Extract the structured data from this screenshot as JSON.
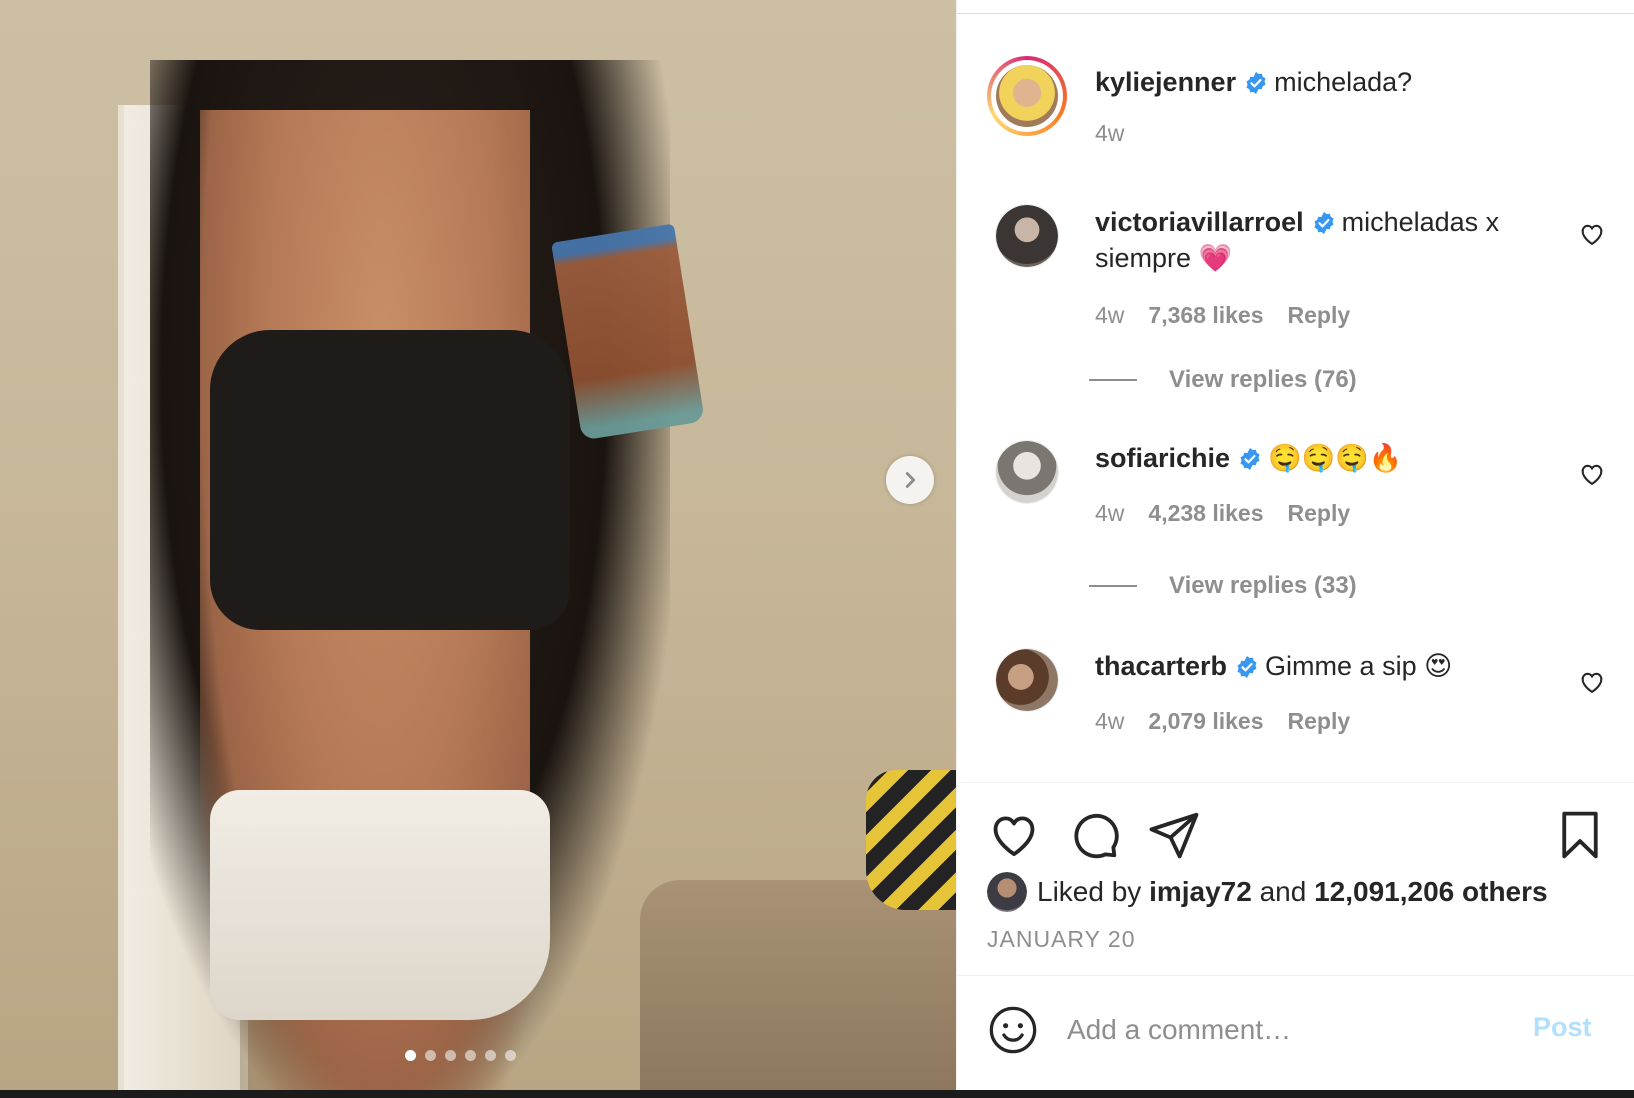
{
  "post": {
    "author": "kyliejenner",
    "caption": "michelada?",
    "time": "4w",
    "carousel_total": 6,
    "carousel_active": 1
  },
  "comments": [
    {
      "user": "victoriavillarroel",
      "text": "micheladas x siempre 💗",
      "time": "4w",
      "likes": "7,368 likes",
      "reply": "Reply",
      "view_replies": "View replies (76)"
    },
    {
      "user": "sofiarichie",
      "text": "🤤🤤🤤🔥",
      "time": "4w",
      "likes": "4,238 likes",
      "reply": "Reply",
      "view_replies": "View replies (33)"
    },
    {
      "user": "thacarterb",
      "text": "Gimme a sip 😍",
      "time": "4w",
      "likes": "2,079 likes",
      "reply": "Reply"
    }
  ],
  "likes": {
    "prefix": "Liked by",
    "user": "imjay72",
    "middle": "and",
    "others": "12,091,206 others"
  },
  "date": "JANUARY 20",
  "comment_box": {
    "placeholder": "Add a comment…",
    "post_label": "Post"
  },
  "colors": {
    "verified": "#3897f0",
    "muted": "#8e8e8e",
    "post_disabled": "#b2dffc"
  },
  "icons": [
    "chevron-right-icon",
    "verified-icon",
    "heart-icon",
    "comment-icon",
    "share-icon",
    "bookmark-icon",
    "emoji-icon"
  ]
}
